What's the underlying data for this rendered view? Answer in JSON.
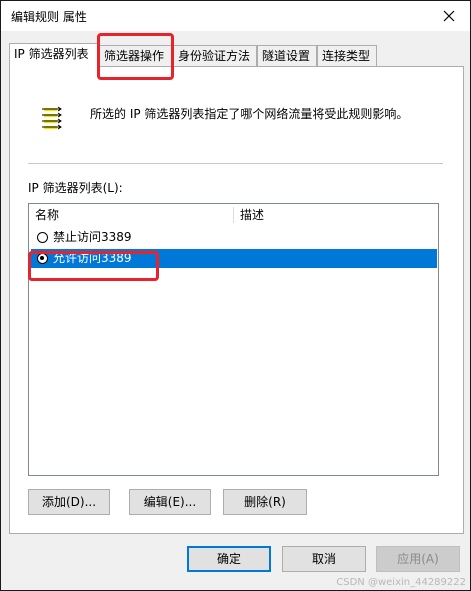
{
  "window": {
    "title": "编辑规则 属性"
  },
  "tabs": [
    {
      "label": "IP 筛选器列表"
    },
    {
      "label": "筛选器操作"
    },
    {
      "label": "身份验证方法"
    },
    {
      "label": "隧道设置"
    },
    {
      "label": "连接类型"
    }
  ],
  "info": {
    "text": "所选的 IP 筛选器列表指定了哪个网络流量将受此规则影响。"
  },
  "filter_list": {
    "label": "IP 筛选器列表(L):",
    "columns": [
      "名称",
      "描述"
    ],
    "rows": [
      {
        "name": "禁止访问3389",
        "description": "",
        "selected": false
      },
      {
        "name": "允许访问3389",
        "description": "",
        "selected": true
      }
    ]
  },
  "actions": {
    "add": "添加(D)...",
    "edit": "编辑(E)...",
    "delete": "删除(R)"
  },
  "dialog": {
    "ok": "确定",
    "cancel": "取消",
    "apply": "应用(A)"
  },
  "watermark": "CSDN @weixin_44289222",
  "colors": {
    "selection": "#0078d7",
    "highlight": "#e8232b"
  }
}
